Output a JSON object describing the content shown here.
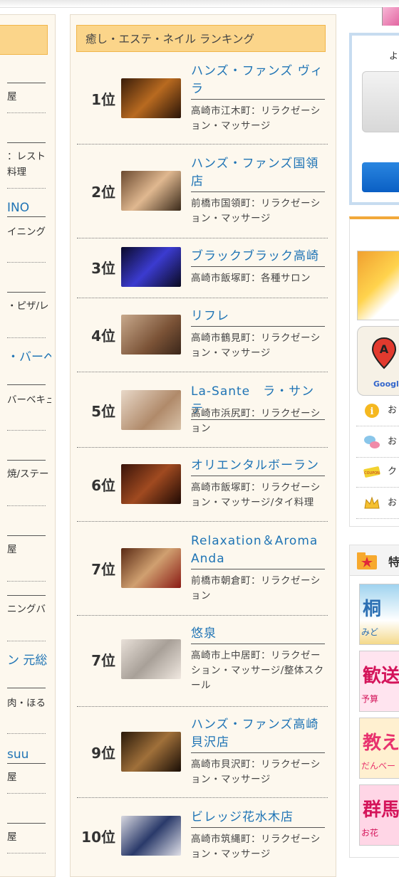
{
  "left_column": {
    "items": [
      {
        "text": "屋",
        "link": false
      },
      {
        "text": "：レスト",
        "link": false
      },
      {
        "text": "料理",
        "link": false
      },
      {
        "text": "INO",
        "link": true
      },
      {
        "text": "イニング",
        "link": false
      },
      {
        "text": "・ピザ/レ",
        "link": false
      },
      {
        "text": "・バーベ",
        "link": true
      },
      {
        "text": "バーベキュ",
        "link": false
      },
      {
        "text": "焼/ステー",
        "link": false
      },
      {
        "text": "屋",
        "link": false
      },
      {
        "text": "ニングバ",
        "link": false
      },
      {
        "text": "ン 元総",
        "link": true
      },
      {
        "text": "肉・ほる",
        "link": false
      },
      {
        "text": "suu",
        "link": true
      },
      {
        "text": "屋",
        "link": false
      },
      {
        "text": "屋",
        "link": false
      }
    ]
  },
  "ranking": {
    "title": "癒し・エステ・ネイル ランキング",
    "items": [
      {
        "rank": "1位",
        "name": "ハンズ・ファンズ ヴィラ",
        "desc": "高崎市江木町：リラクゼーション・マッサージ"
      },
      {
        "rank": "2位",
        "name": "ハンズ・ファンズ国領店",
        "desc": "前橋市国領町：リラクゼーション・マッサージ"
      },
      {
        "rank": "3位",
        "name": "ブラックブラック高崎",
        "desc": "高崎市飯塚町：各種サロン"
      },
      {
        "rank": "4位",
        "name": "リフレ",
        "desc": "高崎市鶴見町：リラクゼーション・マッサージ"
      },
      {
        "rank": "5位",
        "name": "La-Sante　ラ・サンテ",
        "desc": "高崎市浜尻町：リラクゼーション"
      },
      {
        "rank": "6位",
        "name": "オリエンタルボーラン",
        "desc": "高崎市飯塚町：リラクゼーション・マッサージ/タイ料理"
      },
      {
        "rank": "7位",
        "name": "Relaxation＆Aroma Anda",
        "desc": "前橋市朝倉町：リラクゼーション"
      },
      {
        "rank": "7位",
        "name": "悠泉",
        "desc": "高崎市上中居町：リラクゼーション・マッサージ/整体スクール"
      },
      {
        "rank": "9位",
        "name": "ハンズ・ファンズ高崎貝沢店",
        "desc": "高崎市貝沢町：リラクゼーション・マッサージ"
      },
      {
        "rank": "10位",
        "name": "ビレッジ花水木店",
        "desc": "高崎市筑縄町：リラクゼーション・マッサージ"
      }
    ]
  },
  "right_column": {
    "profile_greeting": "よ",
    "links": [
      {
        "icon": "info-icon",
        "label": "お"
      },
      {
        "icon": "chat-bubbles-icon",
        "label": "お"
      },
      {
        "icon": "coupon-icon",
        "label": "ク"
      },
      {
        "icon": "crown-icon",
        "label": "お"
      }
    ],
    "map_logo": "Google",
    "feature_title": "特",
    "banners": [
      {
        "title": "桐",
        "sub": "みど",
        "color": "#2b6fb3"
      },
      {
        "title": "歓送",
        "sub": "予算",
        "color": "#d4145a"
      },
      {
        "title": "教えて",
        "sub": "だんべー",
        "color": "#e8326e"
      },
      {
        "title": "群馬",
        "sub": "お花",
        "color": "#d4145a"
      }
    ]
  }
}
